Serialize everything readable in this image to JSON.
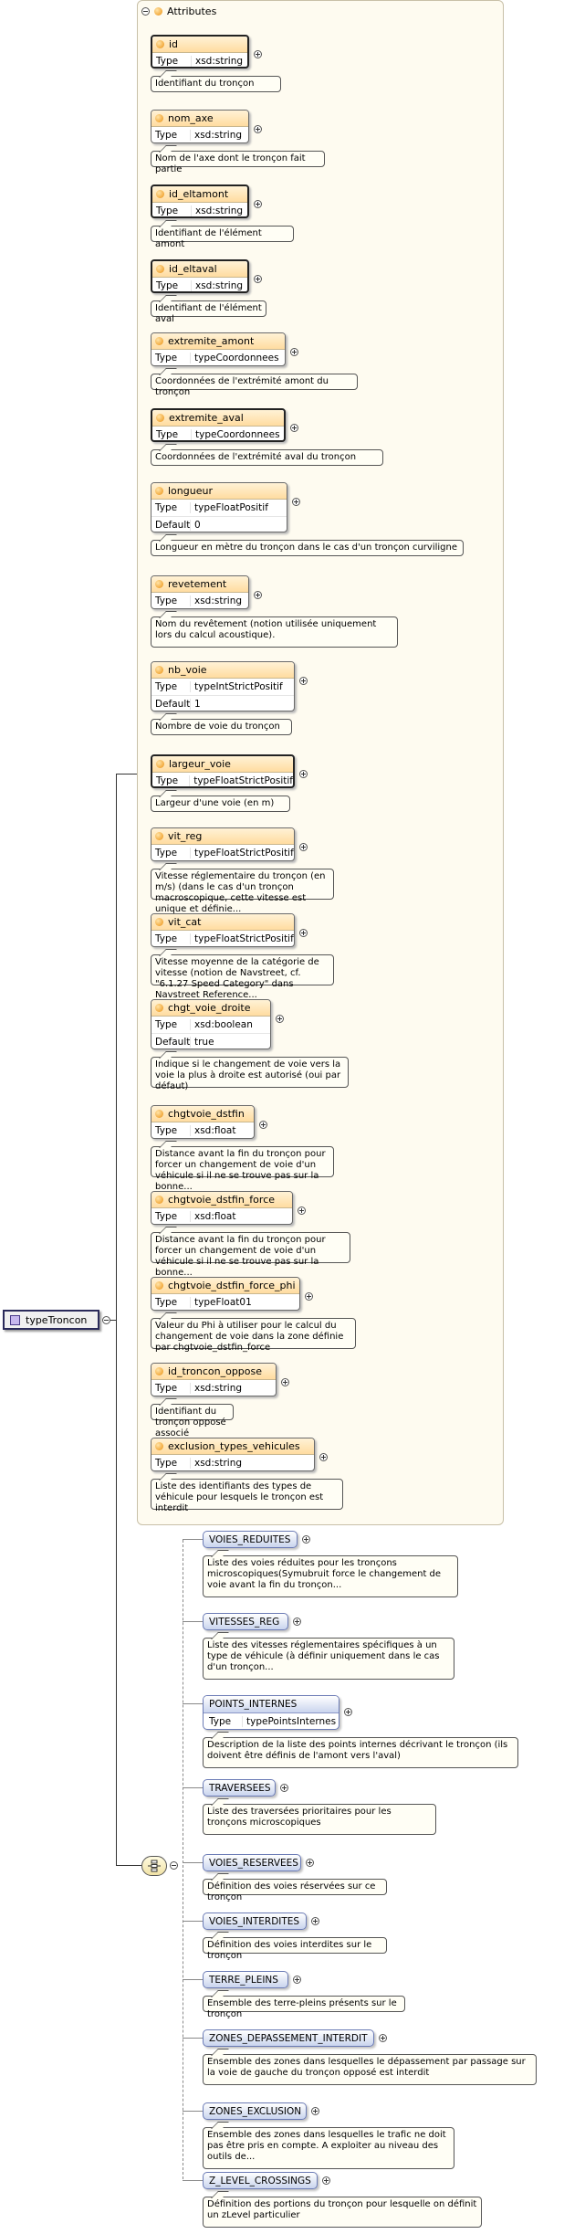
{
  "attributes_title": "Attributes",
  "root_element": "typeTroncon",
  "attributes": [
    {
      "name": "id",
      "type_label": "Type",
      "type": "xsd:string",
      "doc": "Identifiant du tronçon",
      "bold": true
    },
    {
      "name": "nom_axe",
      "type_label": "Type",
      "type": "xsd:string",
      "doc": "Nom de l'axe dont le tronçon fait partie",
      "bold": false
    },
    {
      "name": "id_eltamont",
      "type_label": "Type",
      "type": "xsd:string",
      "doc": "Identifiant de l'élément amont",
      "bold": true
    },
    {
      "name": "id_eltaval",
      "type_label": "Type",
      "type": "xsd:string",
      "doc": "Identifiant de l'élément aval",
      "bold": true
    },
    {
      "name": "extremite_amont",
      "type_label": "Type",
      "type": "typeCoordonnees",
      "doc": "Coordonnées de l'extrémité amont du tronçon",
      "bold": false
    },
    {
      "name": "extremite_aval",
      "type_label": "Type",
      "type": "typeCoordonnees",
      "doc": "Coordonnées de l'extrémité aval du tronçon",
      "bold": true
    },
    {
      "name": "longueur",
      "type_label": "Type",
      "type": "typeFloatPositif",
      "default_label": "Default",
      "default": "0",
      "doc": "Longueur en mètre du tronçon dans le cas d'un tronçon curviligne",
      "bold": false
    },
    {
      "name": "revetement",
      "type_label": "Type",
      "type": "xsd:string",
      "doc": "Nom du revêtement (notion utilisée uniquement lors du calcul acoustique).",
      "bold": false
    },
    {
      "name": "nb_voie",
      "type_label": "Type",
      "type": "typeIntStrictPositif",
      "default_label": "Default",
      "default": "1",
      "doc": "Nombre de voie du tronçon",
      "bold": false
    },
    {
      "name": "largeur_voie",
      "type_label": "Type",
      "type": "typeFloatStrictPositif",
      "doc": "Largeur d'une voie (en m)",
      "bold": true
    },
    {
      "name": "vit_reg",
      "type_label": "Type",
      "type": "typeFloatStrictPositif",
      "doc": "Vitesse réglementaire du tronçon (en m/s) (dans le cas d'un tronçon macroscopique, cette vitesse est unique et définie...",
      "bold": false
    },
    {
      "name": "vit_cat",
      "type_label": "Type",
      "type": "typeFloatStrictPositif",
      "doc": "Vitesse moyenne de la catégorie de vitesse (notion de Navstreet, cf. \"6.1.27 Speed Category\" dans Navstreet Reference...",
      "bold": false
    },
    {
      "name": "chgt_voie_droite",
      "type_label": "Type",
      "type": "xsd:boolean",
      "default_label": "Default",
      "default": "true",
      "doc": "Indique si le changement de voie vers la voie la plus à droite est autorisé (oui par défaut)",
      "bold": false
    },
    {
      "name": "chgtvoie_dstfin",
      "type_label": "Type",
      "type": "xsd:float",
      "doc": "Distance avant la fin du tronçon pour forcer un changement de voie d'un véhicule si il ne se trouve pas sur la bonne...",
      "bold": false
    },
    {
      "name": "chgtvoie_dstfin_force",
      "type_label": "Type",
      "type": "xsd:float",
      "doc": "Distance avant la fin du tronçon pour forcer un changement de voie d'un véhicule si il ne se trouve pas sur la bonne...",
      "bold": false
    },
    {
      "name": "chgtvoie_dstfin_force_phi",
      "type_label": "Type",
      "type": "typeFloat01",
      "doc": "Valeur du Phi à utiliser pour le calcul du changement de voie dans la zone définie par chgtvoie_dstfin_force",
      "bold": false
    },
    {
      "name": "id_troncon_oppose",
      "type_label": "Type",
      "type": "xsd:string",
      "doc": "Identifiant du tronçon opposé associé",
      "bold": false
    },
    {
      "name": "exclusion_types_vehicules",
      "type_label": "Type",
      "type": "xsd:string",
      "doc": "Liste des identifiants des types de véhicule pour lesquels le tronçon est interdit",
      "bold": false
    }
  ],
  "elements": [
    {
      "name": "VOIES_REDUITES",
      "doc": "Liste des voies réduites pour les tronçons microscopiques(Symubruit force le changement de voie avant la fin du tronçon..."
    },
    {
      "name": "VITESSES_REG",
      "doc": "Liste des vitesses réglementaires spécifiques à un type de véhicule (à définir uniquement dans le cas d'un tronçon..."
    },
    {
      "name": "POINTS_INTERNES",
      "type_label": "Type",
      "type": "typePointsInternes",
      "doc": "Description de la liste des points internes décrivant le tronçon (ils doivent être définis de l'amont vers l'aval)"
    },
    {
      "name": "TRAVERSEES",
      "doc": "Liste des traversées prioritaires pour les tronçons microscopiques"
    },
    {
      "name": "VOIES_RESERVEES",
      "doc": "Définition des voies réservées sur ce tronçon"
    },
    {
      "name": "VOIES_INTERDITES",
      "doc": "Définition des voies interdites sur le tronçon"
    },
    {
      "name": "TERRE_PLEINS",
      "doc": "Ensemble des terre-pleins présents sur le tronçon"
    },
    {
      "name": "ZONES_DEPASSEMENT_INTERDIT",
      "doc": "Ensemble des zones dans lesquelles le dépassement par passage sur la voie de gauche du tronçon opposé est interdit"
    },
    {
      "name": "ZONES_EXCLUSION",
      "doc": "Ensemble des zones dans lesquelles le trafic ne doit pas être pris en compte. A exploiter au niveau des outils de..."
    },
    {
      "name": "Z_LEVEL_CROSSINGS",
      "doc": "Définition des portions du tronçon pour lesquelle on définit un zLevel particulier"
    }
  ]
}
